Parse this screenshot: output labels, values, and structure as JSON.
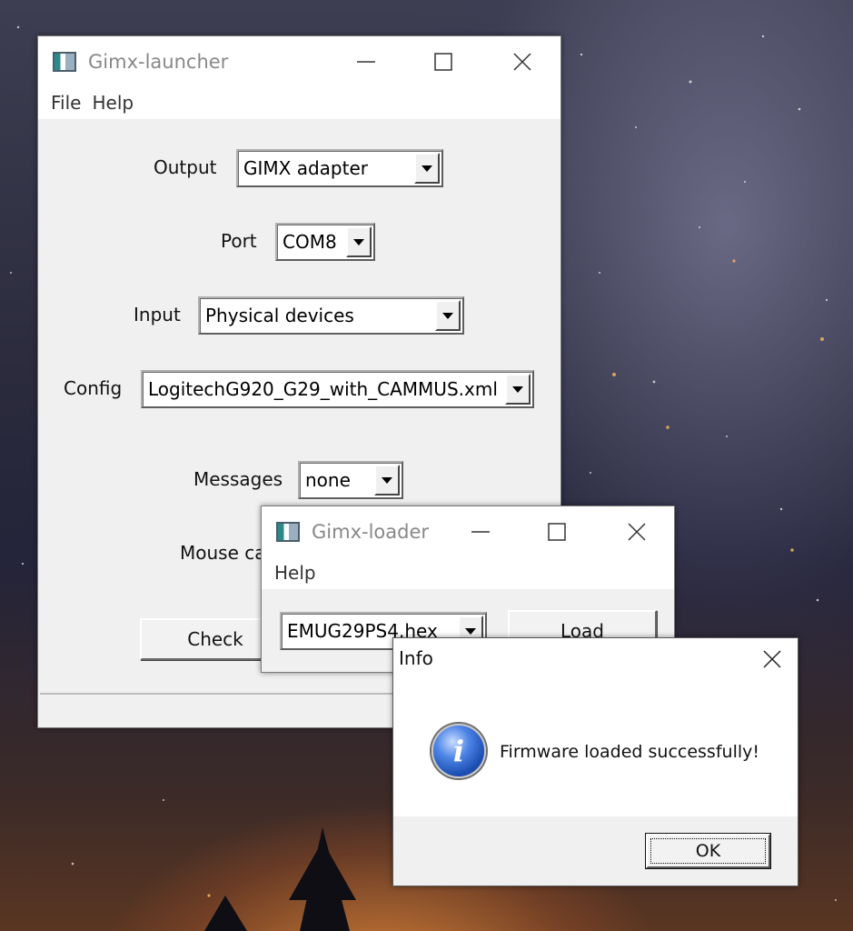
{
  "launcher": {
    "title": "Gimx-launcher",
    "menu": [
      "File",
      "Help"
    ],
    "output_label": "Output",
    "output_value": "GIMX adapter",
    "port_label": "Port",
    "port_value": "COM8",
    "input_label": "Input",
    "input_value": "Physical devices",
    "config_label": "Config",
    "config_value": "LogitechG920_G29_with_CAMMUS.xml",
    "messages_label": "Messages",
    "messages_value": "none",
    "mouse_label": "Mouse ca",
    "check_label": "Check"
  },
  "loader": {
    "title": "Gimx-loader",
    "menu": [
      "Help"
    ],
    "firmware_value": "EMUG29PS4.hex",
    "load_label": "Load"
  },
  "info_dialog": {
    "title": "Info",
    "message": "Firmware loaded successfully!",
    "ok_label": "OK",
    "icon": "info-icon"
  }
}
